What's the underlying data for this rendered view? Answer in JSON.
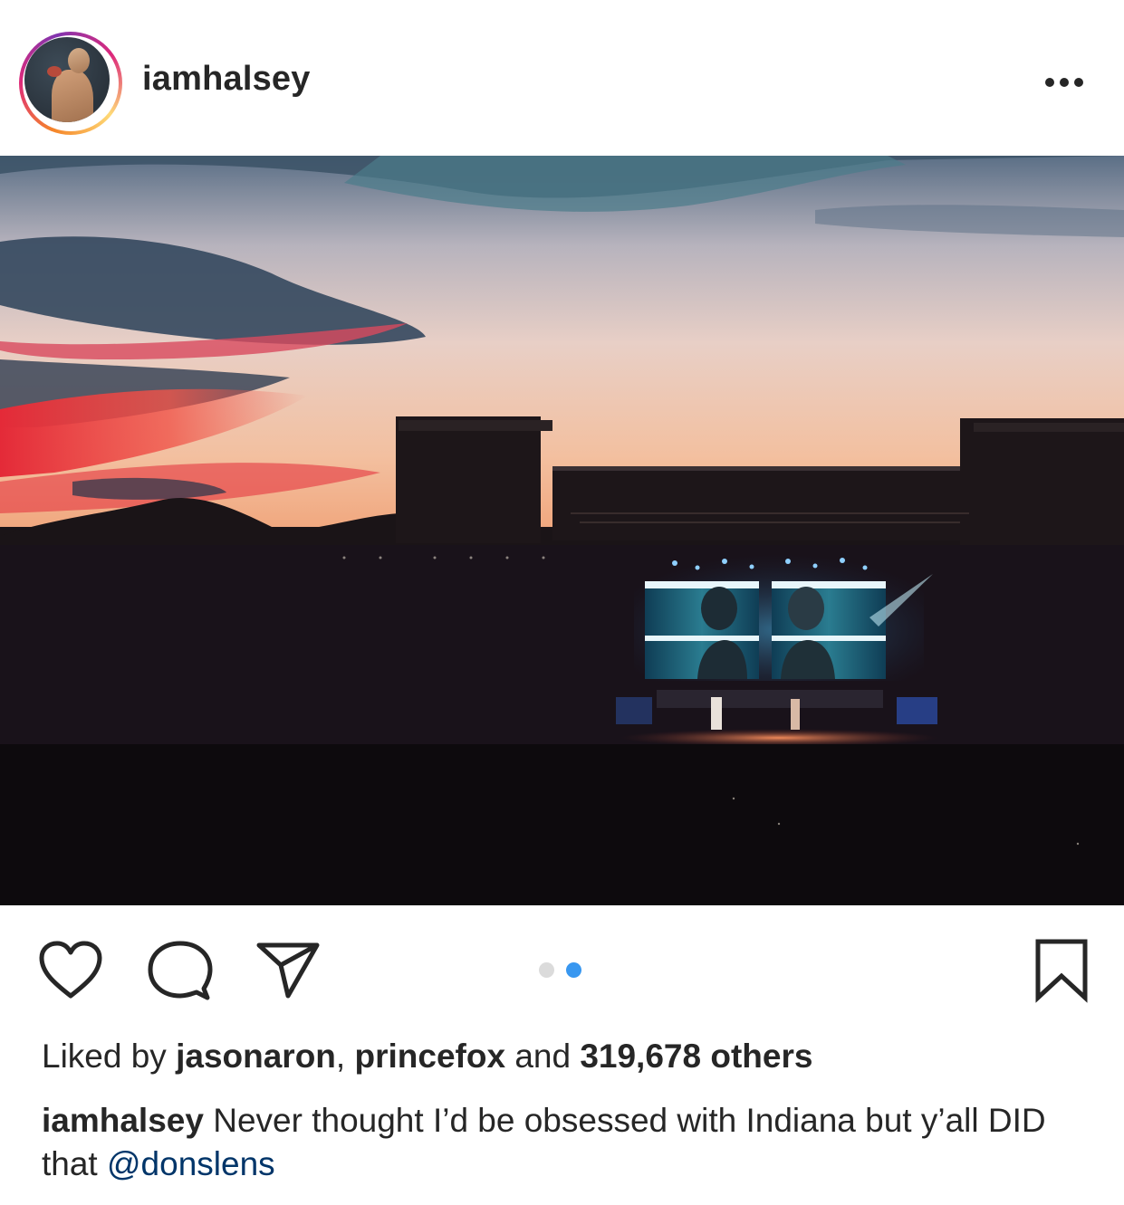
{
  "post": {
    "username": "iamhalsey",
    "more_icon": "more-horizontal-icon"
  },
  "actions": {
    "like_icon": "heart-icon",
    "comment_icon": "comment-icon",
    "share_icon": "send-icon",
    "save_icon": "bookmark-icon",
    "carousel": {
      "total": 2,
      "active_index": 1
    }
  },
  "likes": {
    "prefix": "Liked by",
    "user1": "jasonaron",
    "separator": ",",
    "user2": "princefox",
    "conjunction": "and",
    "count_text": "319,678 others"
  },
  "caption": {
    "username": "iamhalsey",
    "text": "Never thought I’d be obsessed with Indiana but y’all DID that",
    "mention": "@donslens"
  },
  "colors": {
    "text": "#262626",
    "mention": "#003569",
    "carousel_active": "#3897f0",
    "carousel_inactive": "#dbdbdb"
  }
}
